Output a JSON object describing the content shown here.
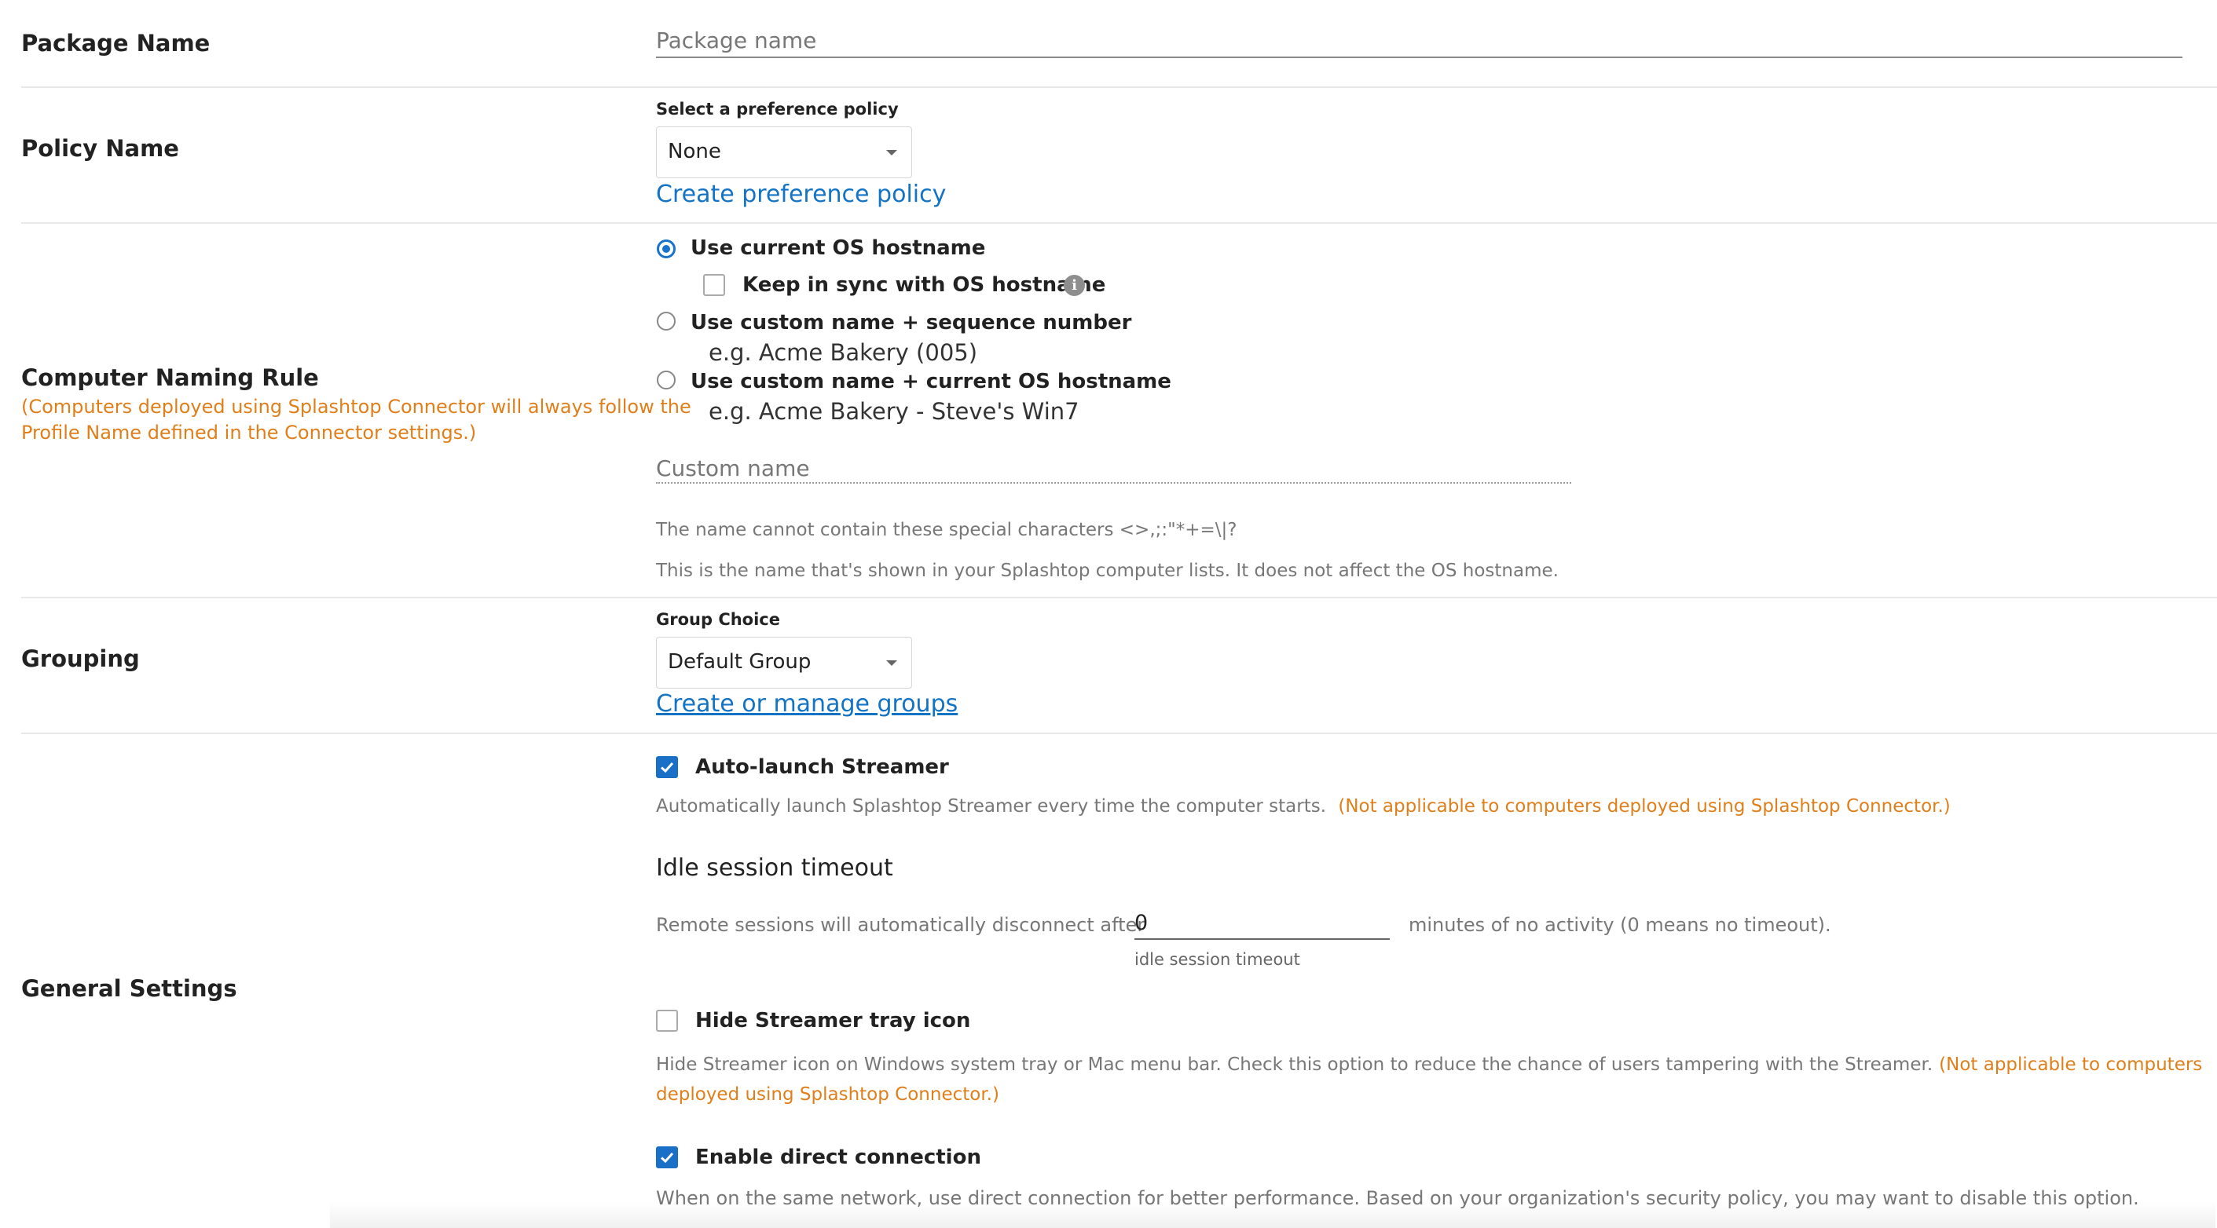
{
  "package_name": {
    "label": "Package Name",
    "placeholder": "Package name"
  },
  "policy": {
    "label": "Policy Name",
    "caption": "Select a preference policy",
    "selected": "None",
    "link": "Create preference policy"
  },
  "naming": {
    "label": "Computer Naming Rule",
    "note": "(Computers deployed using Splashtop Connector will always follow the Profile Name defined in the Connector settings.)",
    "note_line1": "(Computers deployed using Splashtop Connector will always follow the",
    "note_line2": "Profile Name defined in the Connector settings.)",
    "option1": "Use current OS hostname",
    "sync_label": "Keep in sync with OS hostname",
    "option2": "Use custom name + sequence number",
    "option2_example": "e.g. Acme Bakery (005)",
    "option3": "Use custom name + current OS hostname",
    "option3_example": "e.g. Acme Bakery - Steve's Win7",
    "custom_placeholder": "Custom name",
    "hint1": "The name cannot contain these special characters <>,;:\"*+=\\|?",
    "hint2": "This is the name that's shown in your Splashtop computer lists. It does not affect the OS hostname."
  },
  "grouping": {
    "label": "Grouping",
    "caption": "Group Choice",
    "selected": "Default Group",
    "link": "Create or manage groups"
  },
  "general": {
    "label": "General Settings",
    "autolaunch_label": "Auto-launch Streamer",
    "autolaunch_desc": "Automatically launch Splashtop Streamer every time the computer starts.",
    "autolaunch_note": "(Not applicable to computers deployed using Splashtop Connector.)",
    "idle_title": "Idle session timeout",
    "idle_prefix": "Remote sessions will automatically disconnect after",
    "idle_value": "0",
    "idle_suffix": "minutes of no activity (0 means no timeout).",
    "idle_caption": "idle session timeout",
    "hide_tray_label": "Hide Streamer tray icon",
    "hide_tray_desc": "Hide Streamer icon on Windows system tray or Mac menu bar. Check this option to reduce the chance of users tampering with the Streamer.",
    "hide_tray_note_1": "(Not applicable to computers",
    "hide_tray_note_2": "deployed using Splashtop Connector.)",
    "direct_label": "Enable direct connection",
    "direct_desc": "When on the same network, use direct connection for better performance. Based on your organization's security policy, you may want to disable this option."
  },
  "state": {
    "naming_selected": "option1",
    "sync_checked": false,
    "autolaunch_checked": true,
    "hide_tray_checked": false,
    "direct_checked": true
  },
  "colors": {
    "accent": "#1a6fc7",
    "link": "#1373c4",
    "warning_orange": "#e07f1a"
  }
}
